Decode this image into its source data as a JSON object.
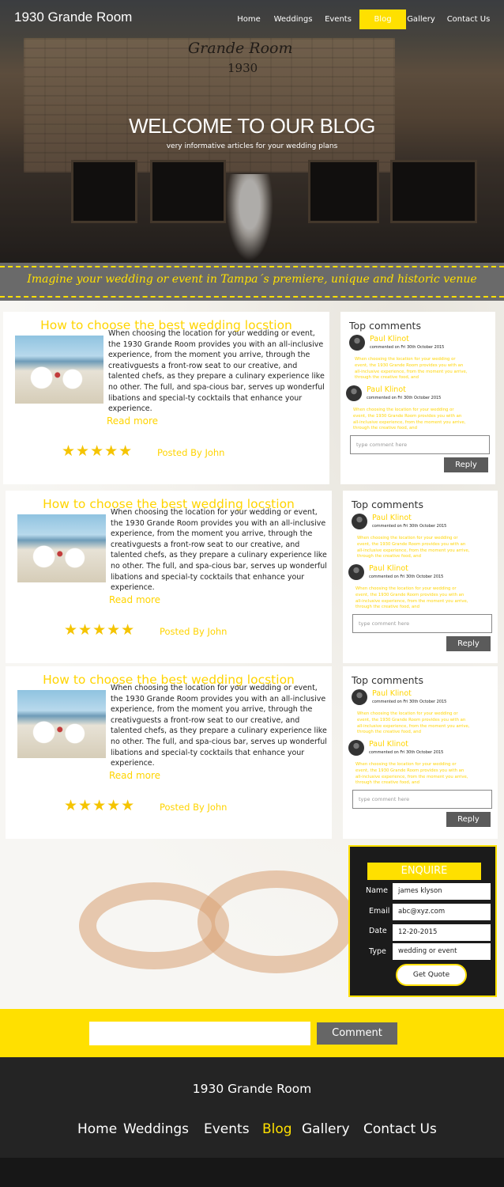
{
  "brand": "1930 Grande Room",
  "nav": [
    {
      "label": "Home",
      "active": false
    },
    {
      "label": "Weddings",
      "active": false
    },
    {
      "label": "Events",
      "active": false
    },
    {
      "label": "Blog",
      "active": true
    },
    {
      "label": "Gallery",
      "active": false
    },
    {
      "label": "Contact Us",
      "active": false
    }
  ],
  "hero": {
    "sign_name": "Grande Room",
    "sign_year": "1930",
    "title": "WELCOME TO OUR BLOG",
    "subtitle": "very informative articles for your wedding plans"
  },
  "tagline": "Imagine your wedding or event in Tampa´s premiere, unique and historic venue",
  "posts": [
    {
      "title": "How to choose the best wedding locstion",
      "text": "When choosing the location for your wedding or event, the 1930 Grande Room provides you with an all-inclusive experience, from the moment you arrive, through the creativguests a front-row seat to our creative, and talented chefs, as they prepare a culinary experience like no other. The full, and spa-cious bar, serves up wonderful libations and special-ty cocktails that enhance your experience.",
      "read_more": "Read more",
      "rating": "★★★★★",
      "posted_by": "Posted By John"
    },
    {
      "title": "How to choose the best wedding locstion",
      "text": "When choosing the location for your wedding or event, the 1930 Grande Room provides you with an all-inclusive experience, from the moment you arrive, through the creativguests a front-row seat to our creative, and talented chefs, as they prepare a culinary experience like no other. The full, and spa-cious bar, serves up wonderful libations and special-ty cocktails that enhance your experience.",
      "read_more": "Read more",
      "rating": "★★★★★",
      "posted_by": "Posted By John"
    },
    {
      "title": "How to choose the best wedding locstion",
      "text": "When choosing the location for your wedding or event, the 1930 Grande Room provides you with an all-inclusive experience, from the moment you arrive, through the creativguests a front-row seat to our creative, and talented chefs, as they prepare a culinary experience like no other. The full, and spa-cious bar, serves up wonderful libations and special-ty cocktails that enhance your experience.",
      "read_more": "Read more",
      "rating": "★★★★★",
      "posted_by": "Posted By John"
    }
  ],
  "comments_panel": {
    "title": "Top comments",
    "comments": [
      {
        "name": "Paul Klinot",
        "meta": "commented on Fri 30th October 2015",
        "text": "When choosing the location for your wedding or event, the 1930 Grande Room provides you with an all-inclusive experience, from the moment you arrive, through the creative food, and"
      },
      {
        "name": "Paul Klinot",
        "meta": "commented on Fri 30th October 2015",
        "text": "When choosing the location for your wedding or event, the 1930 Grande Room provides you with an all-inclusive experience, from the moment you arrive, through the creative food, and"
      }
    ],
    "input_placeholder": "type comment here",
    "reply_label": "Reply"
  },
  "enquire": {
    "title": "ENQUIRE",
    "fields": [
      {
        "label": "Name",
        "value": "james klyson"
      },
      {
        "label": "Email",
        "value": "abc@xyz.com"
      },
      {
        "label": "Date",
        "value": "12-20-2015"
      },
      {
        "label": "Type",
        "value": "wedding or event"
      }
    ],
    "button": "Get Quote"
  },
  "comment_bar": {
    "input_value": "",
    "button": "Comment"
  },
  "footer": {
    "brand": "1930 Grande Room",
    "links": [
      {
        "label": "Home",
        "active": false
      },
      {
        "label": "Weddings",
        "active": false
      },
      {
        "label": "Events",
        "active": false
      },
      {
        "label": "Blog",
        "active": true
      },
      {
        "label": "Gallery",
        "active": false
      },
      {
        "label": "Contact Us",
        "active": false
      }
    ]
  },
  "colors": {
    "accent": "#ffe000",
    "accent_text": "#ffd400",
    "dark": "#242424",
    "button_gray": "#5b5b5b"
  }
}
